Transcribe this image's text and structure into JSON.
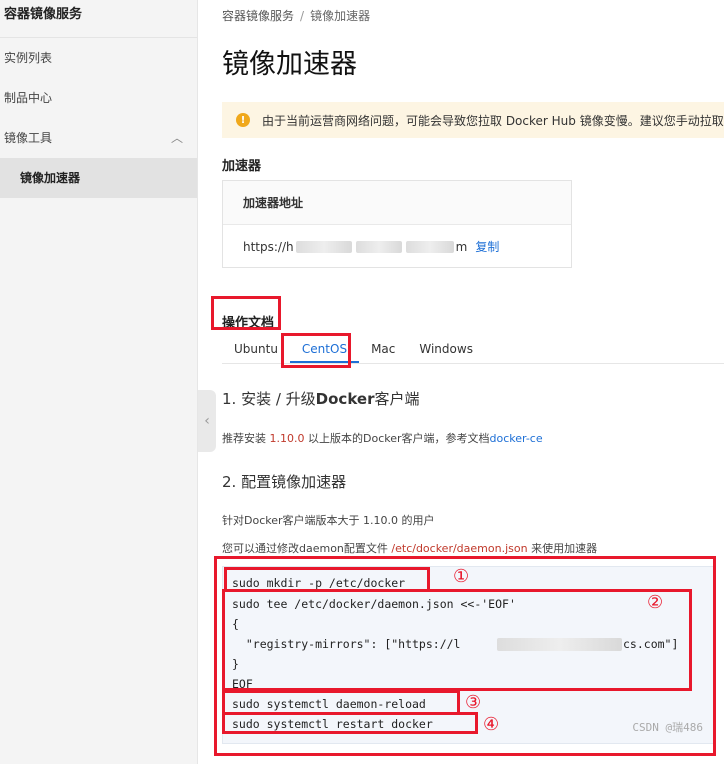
{
  "sidebar": {
    "title": "容器镜像服务",
    "items": [
      {
        "label": "实例列表"
      },
      {
        "label": "制品中心"
      },
      {
        "label": "镜像工具"
      },
      {
        "label": "镜像加速器"
      }
    ]
  },
  "breadcrumb": {
    "root": "容器镜像服务",
    "sep": "/",
    "current": "镜像加速器"
  },
  "page_title": "镜像加速器",
  "alert": {
    "text": "由于当前运营商网络问题，可能会导致您拉取 Docker Hub 镜像变慢。建议您手动拉取镜"
  },
  "accelerator": {
    "section_label": "加速器",
    "card_header": "加速器地址",
    "url_prefix": "https://h",
    "url_suffix": "m",
    "copy_label": "复制"
  },
  "docs": {
    "section_label": "操作文档",
    "tabs": [
      {
        "label": "Ubuntu"
      },
      {
        "label": "CentOS"
      },
      {
        "label": "Mac"
      },
      {
        "label": "Windows"
      }
    ],
    "active_tab": "CentOS",
    "step1": {
      "num": "1. 安装 / 升级",
      "bold": "Docker",
      "rest": "客户端",
      "text_pre": "推荐安装 ",
      "version": "1.10.0",
      "text_mid": " 以上版本的Docker客户端，参考文档",
      "link": "docker-ce"
    },
    "step2": {
      "title": "2. 配置镜像加速器",
      "line1": "针对Docker客户端版本大于 1.10.0 的用户",
      "line2_pre": "您可以通过修改daemon配置文件 ",
      "line2_path": "/etc/docker/daemon.json",
      "line2_post": " 来使用加速器"
    },
    "code": [
      "sudo mkdir -p /etc/docker",
      "sudo tee /etc/docker/daemon.json <<-'EOF'",
      "{",
      "  \"registry-mirrors\": [\"https://l",
      "cs.com\"]",
      "}",
      "EOF",
      "sudo systemctl daemon-reload",
      "sudo systemctl restart docker"
    ]
  },
  "annotations": [
    "①",
    "②",
    "③",
    "④"
  ],
  "watermark": "CSDN @瑞486",
  "colors": {
    "accent": "#1d6fd6",
    "annotation_red": "#e8182c",
    "warning": "#f0a81b"
  }
}
